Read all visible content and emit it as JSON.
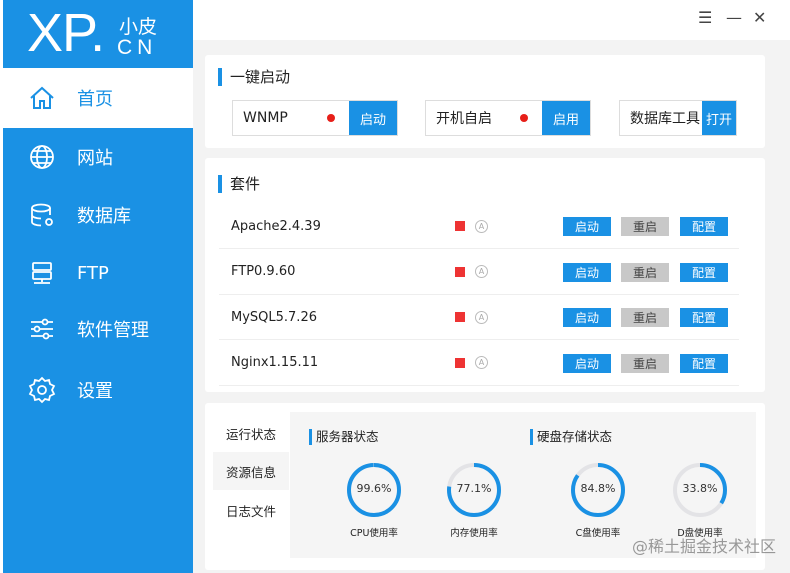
{
  "logo": {
    "main": "XP.",
    "top": "小皮",
    "bottom": "CN"
  },
  "sidebar": {
    "items": [
      {
        "label": "首页",
        "icon": "home-icon"
      },
      {
        "label": "网站",
        "icon": "globe-icon"
      },
      {
        "label": "数据库",
        "icon": "database-icon"
      },
      {
        "label": "FTP",
        "icon": "server-icon"
      },
      {
        "label": "软件管理",
        "icon": "sliders-icon"
      },
      {
        "label": "设置",
        "icon": "gear-icon"
      }
    ]
  },
  "window": {
    "menu": "☰",
    "minimize": "—",
    "close": "✕"
  },
  "quickstart": {
    "title": "一键启动",
    "items": [
      {
        "label": "WNMP",
        "button": "启动",
        "status": "#e71f19"
      },
      {
        "label": "开机自启",
        "button": "启用",
        "status": "#e71f19"
      },
      {
        "label": "数据库工具",
        "button": "打开"
      }
    ]
  },
  "suite": {
    "title": "套件",
    "auto": "A",
    "rows": [
      {
        "name": "Apache2.4.39"
      },
      {
        "name": "FTP0.9.60"
      },
      {
        "name": "MySQL5.7.26"
      },
      {
        "name": "Nginx1.15.11"
      }
    ],
    "buttons": {
      "start": "启动",
      "restart": "重启",
      "config": "配置"
    }
  },
  "status": {
    "tabs": [
      "运行状态",
      "资源信息",
      "日志文件"
    ],
    "server_title": "服务器状态",
    "disk_title": "硬盘存储状态",
    "gauges": [
      {
        "label": "CPU使用率",
        "text": "99.6%",
        "value": 99.6
      },
      {
        "label": "内存使用率",
        "text": "77.1%",
        "value": 77.1
      },
      {
        "label": "C盘使用率",
        "text": "84.8%",
        "value": 84.8
      },
      {
        "label": "D盘使用率",
        "text": "33.8%",
        "value": 33.8
      }
    ]
  },
  "watermark": "@稀土掘金技术社区",
  "colors": {
    "accent": "#1a91e4",
    "status_red": "#e71f19"
  }
}
